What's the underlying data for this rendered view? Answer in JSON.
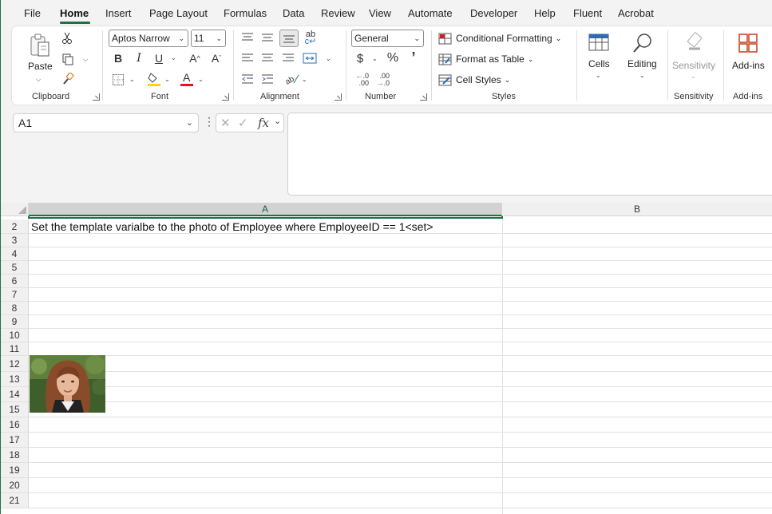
{
  "menu": {
    "tabs": [
      "File",
      "Home",
      "Insert",
      "Page Layout",
      "Formulas",
      "Data",
      "Review",
      "View",
      "Automate",
      "Developer",
      "Help",
      "Fluent",
      "Acrobat"
    ],
    "active": "Home"
  },
  "ribbon": {
    "clipboard": {
      "paste_label": "Paste",
      "group_label": "Clipboard"
    },
    "font": {
      "family": "Aptos Narrow",
      "size": "11",
      "group_label": "Font"
    },
    "alignment": {
      "group_label": "Alignment"
    },
    "number": {
      "format": "General",
      "group_label": "Number"
    },
    "styles": {
      "conditional_formatting": "Conditional Formatting",
      "format_as_table": "Format as Table",
      "cell_styles": "Cell Styles",
      "group_label": "Styles"
    },
    "cells": {
      "label": "Cells"
    },
    "editing": {
      "label": "Editing"
    },
    "sensitivity": {
      "label": "Sensitivity",
      "group_label": "Sensitivity"
    },
    "addins": {
      "label": "Add-ins",
      "group_label": "Add-ins"
    }
  },
  "formula_bar": {
    "name_box": "A1",
    "fx": "fx",
    "formula": ""
  },
  "sheet": {
    "columns": [
      "A",
      "B"
    ],
    "selected_column": "A",
    "rows": [
      "2",
      "3",
      "4",
      "5",
      "6",
      "7",
      "8",
      "9",
      "10",
      "11",
      "12",
      "13",
      "14",
      "15",
      "16",
      "17",
      "18",
      "19",
      "20",
      "21"
    ],
    "cell_A2": "Set the template varialbe to the photo of Employee where EmployeeID == 1<set>"
  },
  "colors": {
    "accent": "#1e7145",
    "font_color_bar": "#e81123",
    "fill_color_bar": "#ffd400"
  }
}
